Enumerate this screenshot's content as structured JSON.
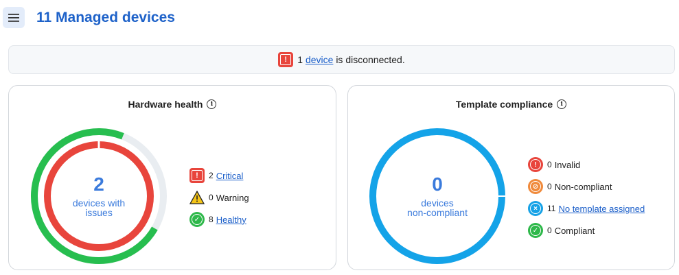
{
  "header": {
    "title": "11 Managed devices"
  },
  "banner": {
    "count": "1",
    "link_text": "device",
    "suffix": "is disconnected."
  },
  "hardware_health": {
    "title": "Hardware health",
    "center": {
      "value": "2",
      "line1": "devices with",
      "line2": "issues"
    },
    "legend": [
      {
        "count": "2",
        "label": "Critical",
        "link": true,
        "icon": "critical-icon",
        "color": "#e8453c"
      },
      {
        "count": "0",
        "label": "Warning",
        "link": false,
        "icon": "warning-icon",
        "color": "#f5c518"
      },
      {
        "count": "8",
        "label": "Healthy",
        "link": true,
        "icon": "healthy-icon",
        "color": "#2eb84a"
      }
    ],
    "colors": {
      "critical": "#e8453c",
      "healthy": "#27be4f",
      "track": "#e9edf1"
    },
    "chart_data": {
      "type": "pie",
      "outer_ring": {
        "healthy": 8,
        "other": 3
      },
      "inner_ring": {
        "critical": 2
      }
    }
  },
  "template_compliance": {
    "title": "Template compliance",
    "center": {
      "value": "0",
      "line1": "devices",
      "line2": "non-compliant"
    },
    "legend": [
      {
        "count": "0",
        "label": "Invalid",
        "link": false,
        "icon": "invalid-icon",
        "color": "#e8453c"
      },
      {
        "count": "0",
        "label": "Non-compliant",
        "link": false,
        "icon": "non-compliant-icon",
        "color": "#f08a3c"
      },
      {
        "count": "11",
        "label": "No template assigned",
        "link": true,
        "icon": "no-template-icon",
        "color": "#17a2e6"
      },
      {
        "count": "0",
        "label": "Compliant",
        "link": false,
        "icon": "compliant-icon",
        "color": "#2eb84a"
      }
    ],
    "colors": {
      "no_template": "#14a3e8"
    },
    "chart_data": {
      "type": "pie",
      "ring": {
        "no_template_assigned": 11
      }
    }
  }
}
